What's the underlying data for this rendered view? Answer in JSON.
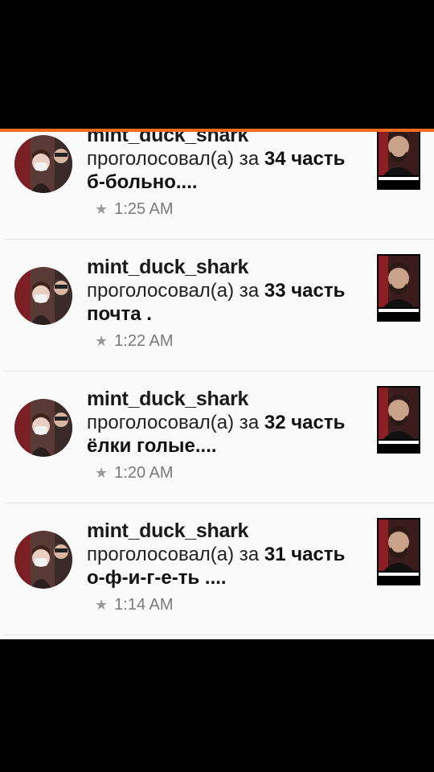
{
  "notifications": [
    {
      "username": "mint_duck_shark",
      "action": "проголосовал(а) за",
      "part": "34 часть",
      "title": "б-больно....",
      "time": "1:25 AM"
    },
    {
      "username": "mint_duck_shark",
      "action": "проголосовал(а) за",
      "part": "33 часть",
      "title": "почта .",
      "time": "1:22 AM"
    },
    {
      "username": "mint_duck_shark",
      "action": "проголосовал(а) за",
      "part": "32 часть",
      "title": "ёлки голые....",
      "time": "1:20 AM"
    },
    {
      "username": "mint_duck_shark",
      "action": "проголосовал(а) за",
      "part": "31 часть",
      "title": "о-ф-и-г-е-ть ....",
      "time": "1:14 AM"
    }
  ],
  "icons": {
    "time": "star-icon",
    "avatar": "user-avatar",
    "cover": "story-cover"
  },
  "colors": {
    "accent": "#f26b22",
    "background": "#fafafa",
    "text": "#111111",
    "muted": "#7a7a7a"
  }
}
